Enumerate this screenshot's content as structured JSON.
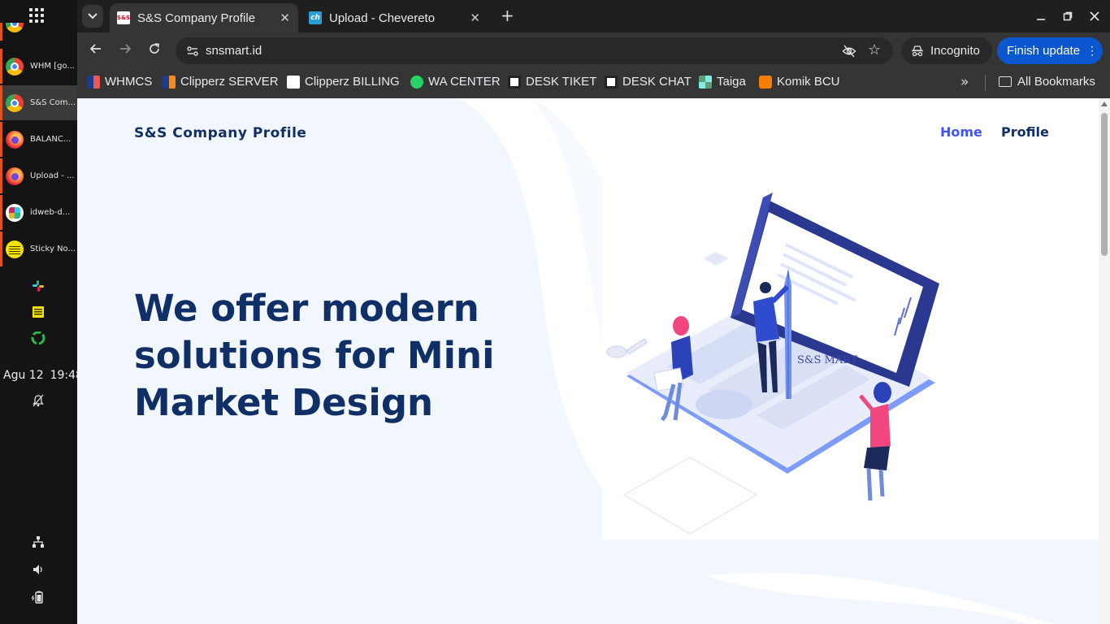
{
  "os_panel": {
    "tasks": [
      {
        "label": "WHM [go...",
        "icon": "chrome-icon"
      },
      {
        "label": "S&S Com...",
        "icon": "chrome-icon"
      },
      {
        "label": "BALANC...",
        "icon": "firefox-icon"
      },
      {
        "label": "Upload - ...",
        "icon": "firefox-icon"
      },
      {
        "label": "idweb-d...",
        "icon": "slack-icon"
      },
      {
        "label": "Sticky No...",
        "icon": "sticky-notes-icon"
      }
    ],
    "clock": {
      "date": "Agu 12",
      "time": "19:48"
    }
  },
  "browser": {
    "tabs": [
      {
        "title": "S&S Company Profile",
        "favicon_text": "S&S",
        "active": true
      },
      {
        "title": "Upload - Chevereto",
        "favicon_text": "ch",
        "active": false
      }
    ],
    "url": "snsmart.id",
    "incognito_label": "Incognito",
    "finish_update_label": "Finish update",
    "bookmarks": [
      {
        "label": "WHMCS"
      },
      {
        "label": "Clipperz SERVER"
      },
      {
        "label": "Clipperz BILLING"
      },
      {
        "label": "WA CENTER"
      },
      {
        "label": "DESK TIKET"
      },
      {
        "label": "DESK CHAT"
      },
      {
        "label": "Taiga"
      },
      {
        "label": "Komik BCU"
      }
    ],
    "all_bookmarks_label": "All Bookmarks",
    "colors": {
      "accent": "#0b57d0",
      "toolbar": "#353535",
      "tabstrip": "#1f1f1f"
    }
  },
  "page": {
    "site_title": "S&S Company Profile",
    "nav": {
      "home": "Home",
      "profile": "Profile"
    },
    "hero_heading": "We offer modern solutions for Mini Market Design",
    "illustration_text": "S&S MART",
    "colors": {
      "primary": "#0f2f66",
      "link": "#4154f1",
      "hero_bg": "#f2f6fd"
    }
  }
}
